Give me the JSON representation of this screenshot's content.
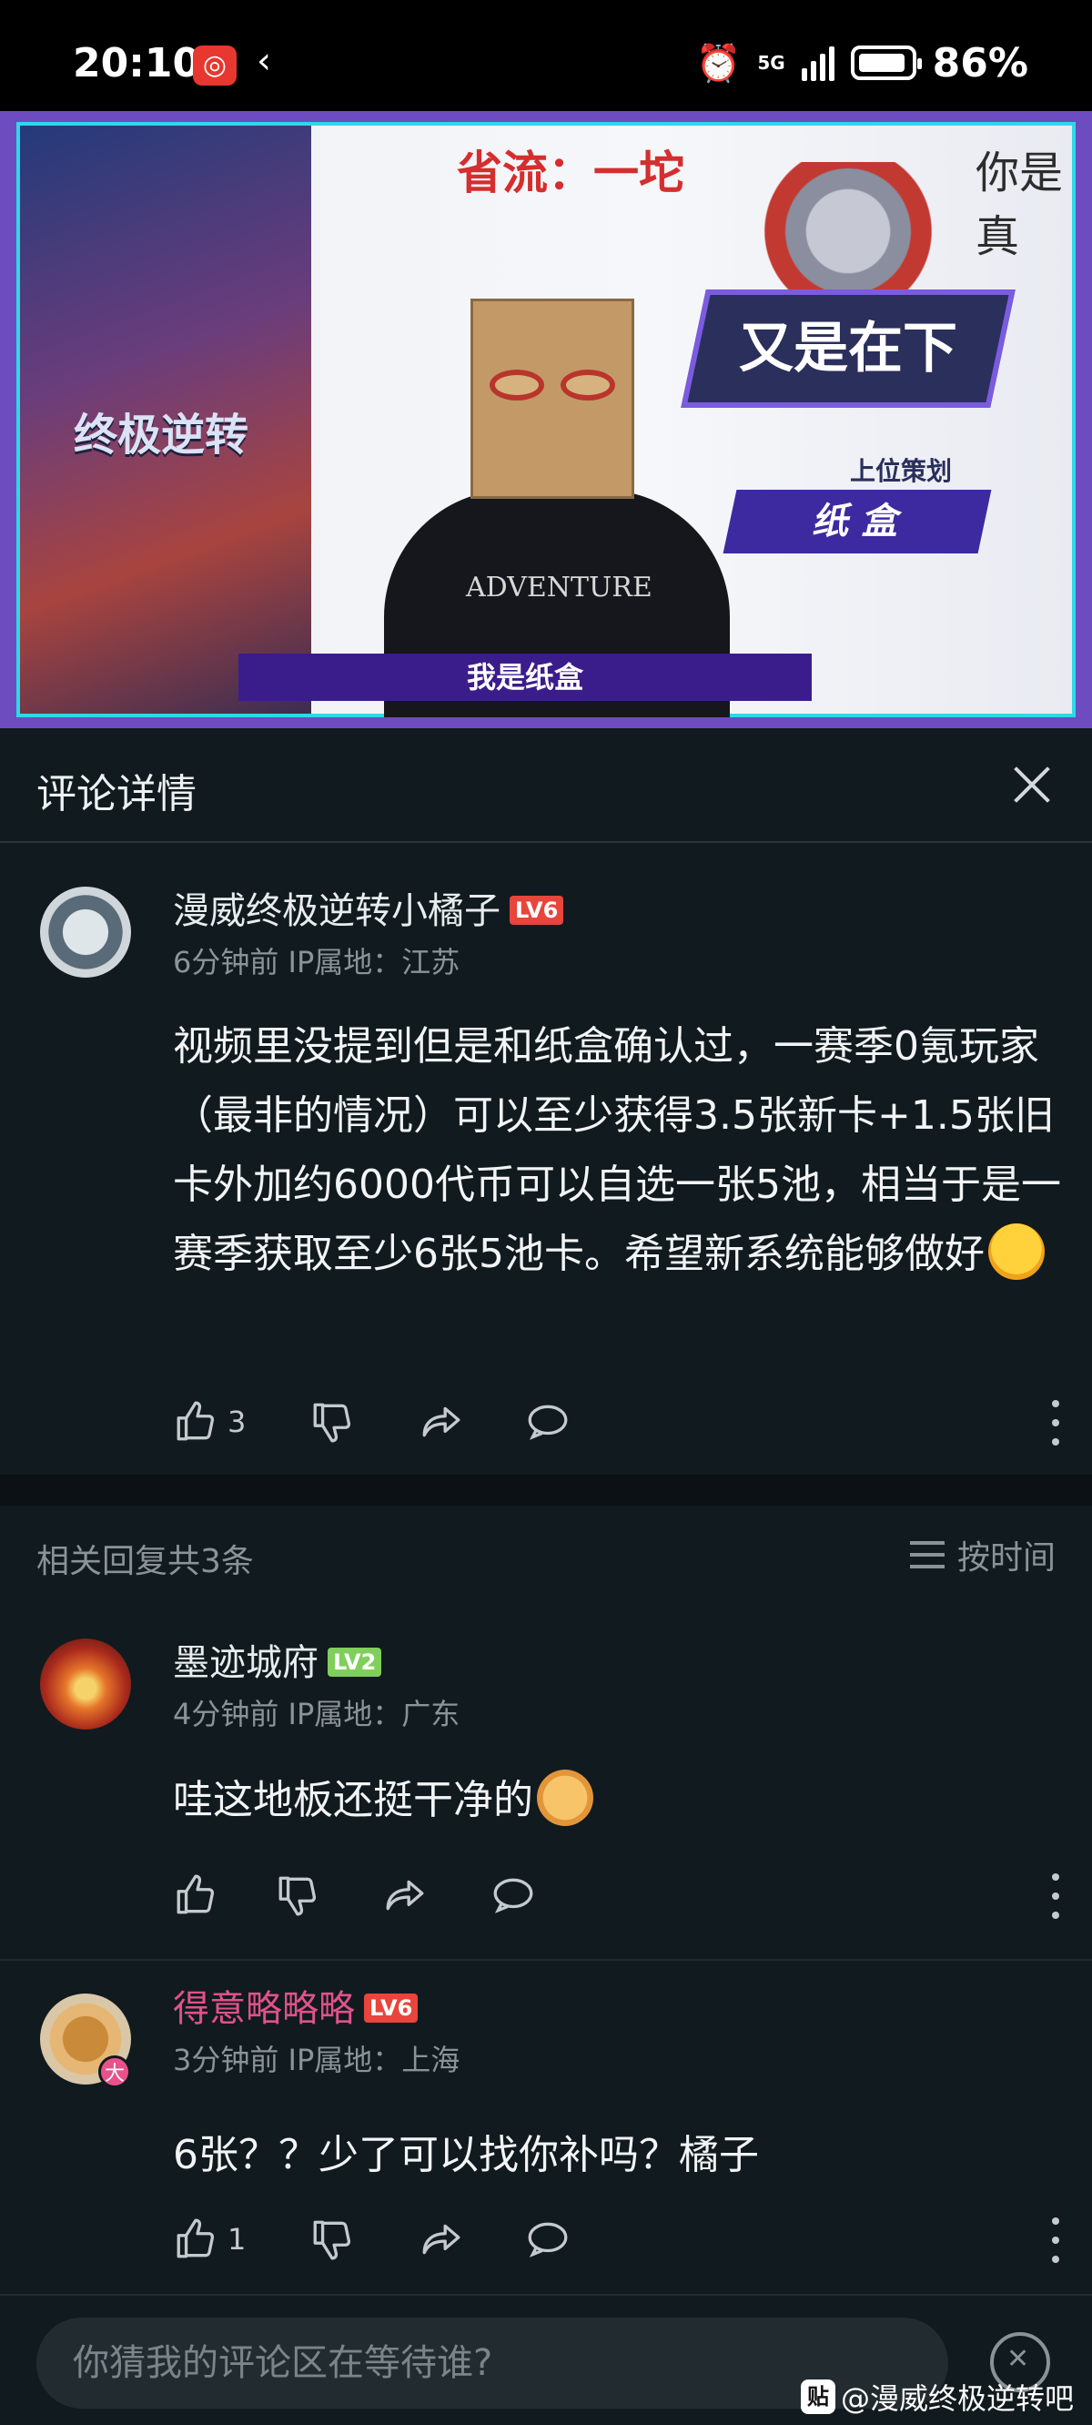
{
  "status_bar": {
    "time": "20:10",
    "network": "5G",
    "battery": "86%"
  },
  "video": {
    "top_caption": "省流：一坨",
    "right_caption": "你是真",
    "poster_title": "终极逆转",
    "badge_text": "又是在下",
    "role_label": "上位策划",
    "name_label": "纸 盒",
    "shirt_text": "ADVENTURE",
    "subtitle": "我是纸盒"
  },
  "panel": {
    "title": "评论详情"
  },
  "main_comment": {
    "username": "漫威终极逆转小橘子",
    "level": "LV6",
    "meta": "6分钟前 IP属地：江苏",
    "text": "视频里没提到但是和纸盒确认过，一赛季0氪玩家（最非的情况）可以至少获得3.5张新卡+1.5张旧卡外加约6000代币可以自选一张5池，相当于是一赛季获取至少6张5池卡。希望新系统能够做好",
    "likes": "3"
  },
  "replies_header": {
    "count_label": "相关回复共3条",
    "sort_label": "按时间"
  },
  "replies": [
    {
      "username": "墨迹城府",
      "level": "LV2",
      "meta": "4分钟前 IP属地：广东",
      "text": "哇这地板还挺干净的",
      "likes": ""
    },
    {
      "username": "得意略略略",
      "level": "LV6",
      "meta": "3分钟前 IP属地：上海",
      "text": "6张？？少了可以找你补吗？橘子",
      "likes": "1"
    }
  ],
  "composer": {
    "placeholder": "你猜我的评论区在等待谁?"
  },
  "watermark": {
    "text": "@漫威终极逆转吧"
  },
  "colors": {
    "background": "#111a1e",
    "lv6": "#e8453c",
    "lv2": "#7fcf5a",
    "highlight_username": "#e0528a"
  }
}
